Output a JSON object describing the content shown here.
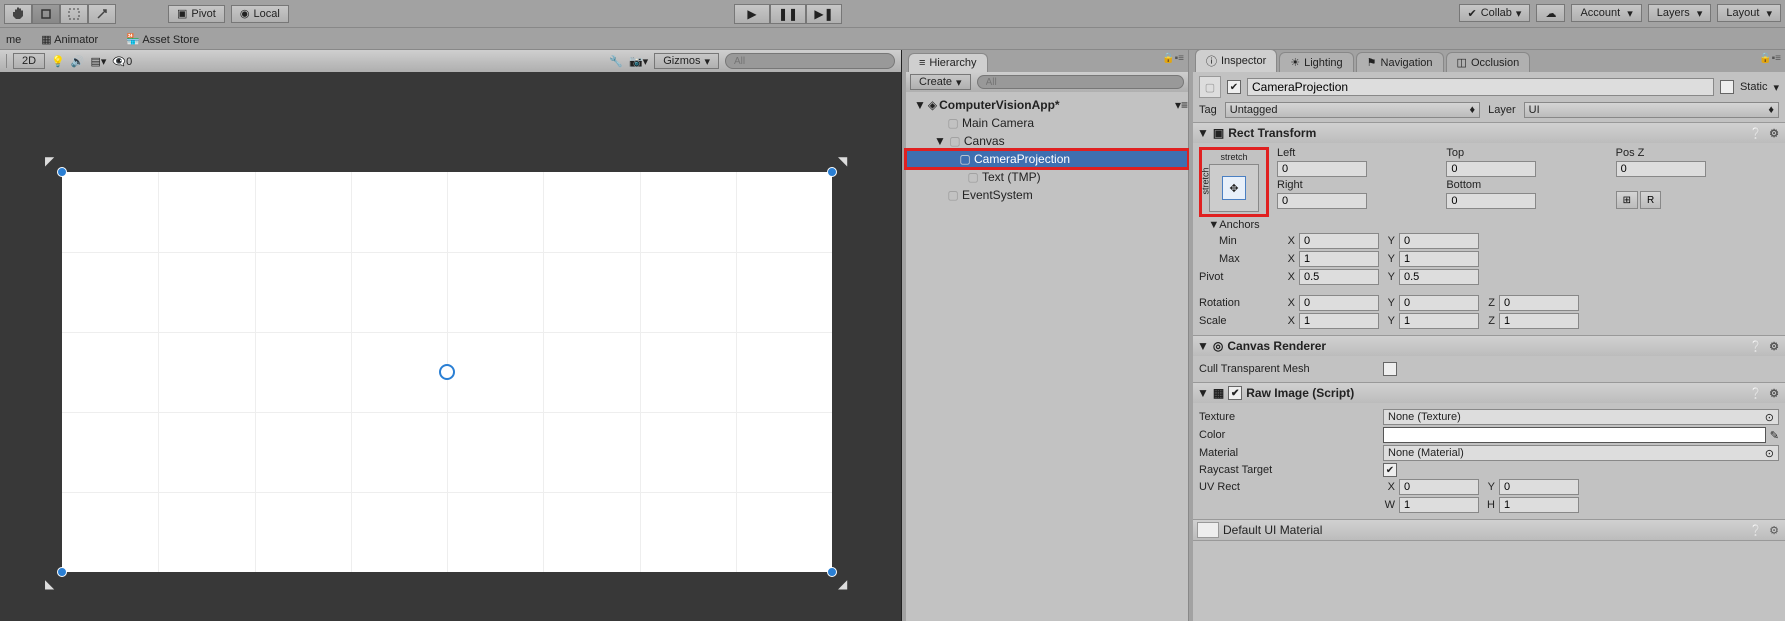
{
  "toolbar": {
    "pivot": "Pivot",
    "local": "Local",
    "collab": "Collab",
    "account": "Account",
    "layers": "Layers",
    "layout": "Layout"
  },
  "tabs": {
    "game": "me",
    "animator": "Animator",
    "assetstore": "Asset Store"
  },
  "scene_toolbar": {
    "mode2d": "2D",
    "gizmos": "Gizmos",
    "zero": "0",
    "search_placeholder": "All"
  },
  "hierarchy": {
    "tab": "Hierarchy",
    "create": "Create",
    "search_placeholder": "All",
    "root": "ComputerVisionApp*",
    "items": {
      "main_camera": "Main Camera",
      "canvas": "Canvas",
      "camera_projection": "CameraProjection",
      "text_tmp": "Text (TMP)",
      "event_system": "EventSystem"
    }
  },
  "inspector": {
    "tabs": {
      "inspector": "Inspector",
      "lighting": "Lighting",
      "navigation": "Navigation",
      "occlusion": "Occlusion"
    },
    "name": "CameraProjection",
    "static": "Static",
    "tag_label": "Tag",
    "tag_value": "Untagged",
    "layer_label": "Layer",
    "layer_value": "UI",
    "rect_transform": {
      "title": "Rect Transform",
      "stretch": "stretch",
      "left": "Left",
      "left_v": "0",
      "top": "Top",
      "top_v": "0",
      "posz": "Pos Z",
      "posz_v": "0",
      "right": "Right",
      "right_v": "0",
      "bottom": "Bottom",
      "bottom_v": "0",
      "r_btn": "R",
      "anchors": "Anchors",
      "min": "Min",
      "min_x": "0",
      "min_y": "0",
      "max": "Max",
      "max_x": "1",
      "max_y": "1",
      "pivot": "Pivot",
      "pivot_x": "0.5",
      "pivot_y": "0.5",
      "rotation": "Rotation",
      "rot_x": "0",
      "rot_y": "0",
      "rot_z": "0",
      "scale": "Scale",
      "scale_x": "1",
      "scale_y": "1",
      "scale_z": "1"
    },
    "canvas_renderer": {
      "title": "Canvas Renderer",
      "cull": "Cull Transparent Mesh"
    },
    "raw_image": {
      "title": "Raw Image (Script)",
      "texture": "Texture",
      "texture_v": "None (Texture)",
      "color": "Color",
      "material": "Material",
      "material_v": "None (Material)",
      "raycast": "Raycast Target",
      "uvrect": "UV Rect",
      "uv_x": "0",
      "uv_y": "0",
      "uv_w": "1",
      "uv_h": "1"
    },
    "default_material": "Default UI Material"
  }
}
